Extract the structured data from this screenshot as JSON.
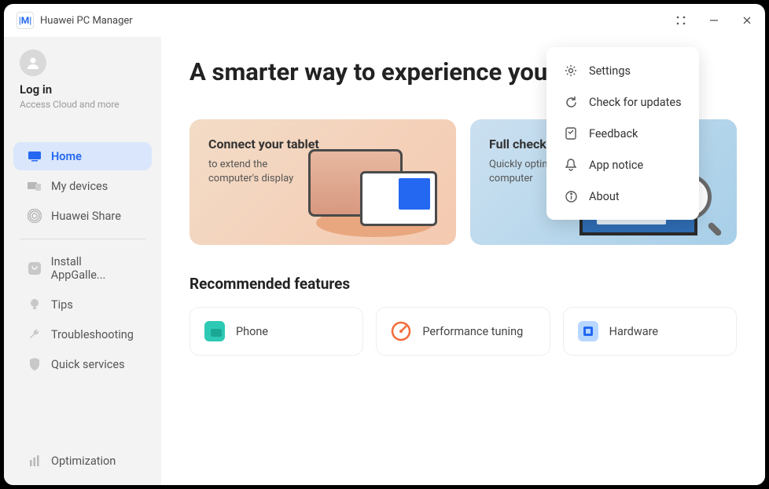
{
  "app": {
    "title": "Huawei PC Manager"
  },
  "profile": {
    "login": "Log in",
    "sub": "Access Cloud and more"
  },
  "nav": {
    "home": "Home",
    "devices": "My devices",
    "share": "Huawei Share",
    "appgallery": "Install AppGalle...",
    "tips": "Tips",
    "trouble": "Troubleshooting",
    "quick": "Quick services",
    "optim": "Optimization"
  },
  "hero": "A smarter way to experience your PC",
  "cards": {
    "a": {
      "title": "Connect your tablet",
      "sub": "to extend the computer's display"
    },
    "b": {
      "title": "Full checkup",
      "sub": "Quickly optimize your computer"
    }
  },
  "section": "Recommended features",
  "rec": {
    "phone": "Phone",
    "perf": "Performance tuning",
    "hw": "Hardware"
  },
  "menu": {
    "settings": "Settings",
    "updates": "Check for updates",
    "feedback": "Feedback",
    "notice": "App notice",
    "about": "About"
  }
}
